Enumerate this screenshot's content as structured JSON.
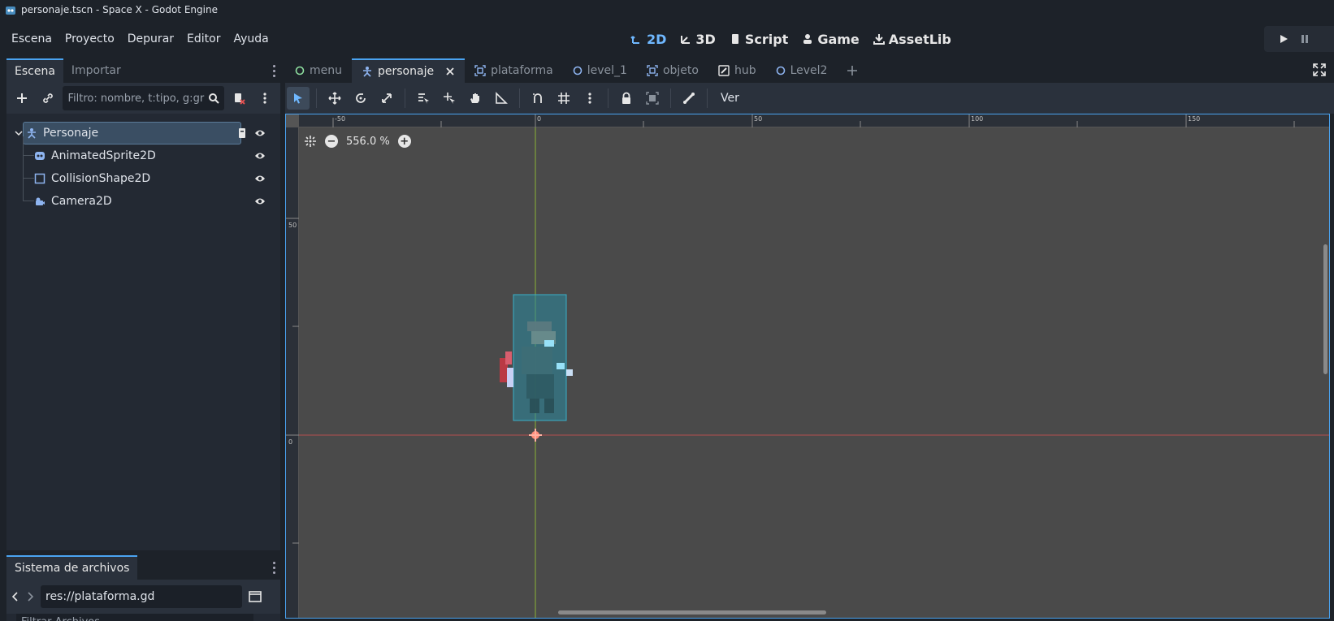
{
  "window": {
    "title": "personaje.tscn - Space X - Godot Engine"
  },
  "menu": [
    "Escena",
    "Proyecto",
    "Depurar",
    "Editor",
    "Ayuda"
  ],
  "modes": [
    {
      "label": "2D",
      "icon": "2d-icon",
      "active": true
    },
    {
      "label": "3D",
      "icon": "3d-icon"
    },
    {
      "label": "Script",
      "icon": "script-icon"
    },
    {
      "label": "Game",
      "icon": "game-icon"
    },
    {
      "label": "AssetLib",
      "icon": "assetlib-icon"
    }
  ],
  "scene_dock": {
    "tabs": [
      "Escena",
      "Importar"
    ],
    "filter_placeholder": "Filtro: nombre, t:tipo, g:gr",
    "nodes": [
      {
        "label": "Personaje",
        "icon": "character-body-icon",
        "selected": true
      },
      {
        "label": "AnimatedSprite2D",
        "icon": "animated-sprite-icon"
      },
      {
        "label": "CollisionShape2D",
        "icon": "collision-shape-icon"
      },
      {
        "label": "Camera2D",
        "icon": "camera-icon"
      }
    ]
  },
  "filesystem_dock": {
    "tab": "Sistema de archivos",
    "path": "res://plataforma.gd",
    "filter": "Filtrar Archivos"
  },
  "editor_tabs": [
    {
      "label": "menu",
      "icon": "circle-icon"
    },
    {
      "label": "personaje",
      "icon": "character-body-icon",
      "active": true
    },
    {
      "label": "plataforma",
      "icon": "scene-icon"
    },
    {
      "label": "level_1",
      "icon": "circle-icon"
    },
    {
      "label": "objeto",
      "icon": "scene-icon"
    },
    {
      "label": "hub",
      "icon": "edit-icon"
    },
    {
      "label": "Level2",
      "icon": "circle-icon"
    }
  ],
  "toolbar": {
    "view_label": "Ver"
  },
  "viewport": {
    "zoom": "556.0 %",
    "ruler_h": [
      "-50",
      "0",
      "50",
      "100",
      "150"
    ],
    "ruler_v": [
      "50",
      "0"
    ]
  },
  "colors": {
    "accent": "#4aa3f0",
    "bg": "#1d2229",
    "panel": "#232933",
    "viewport": "#4a4a4a"
  }
}
